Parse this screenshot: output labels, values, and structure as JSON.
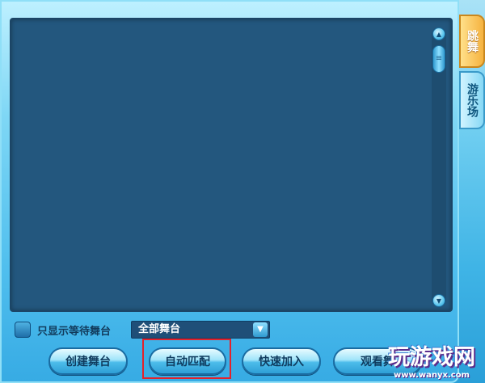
{
  "filter": {
    "checkbox_label": "只显示等待舞台",
    "select_value": "全部舞台"
  },
  "buttons": {
    "create": "创建舞台",
    "auto_match": "自动匹配",
    "quick_join": "快速加入",
    "watch": "观看舞"
  },
  "side_tabs": {
    "dance": "跳舞",
    "amusement": "游乐场"
  },
  "watermark": {
    "logo_text": "玩游戏网",
    "url": "www.wanyx.com"
  },
  "colors": {
    "panel_bg": "#23577e",
    "highlight_border": "#e3222b",
    "active_tab": "#f5b23f"
  }
}
